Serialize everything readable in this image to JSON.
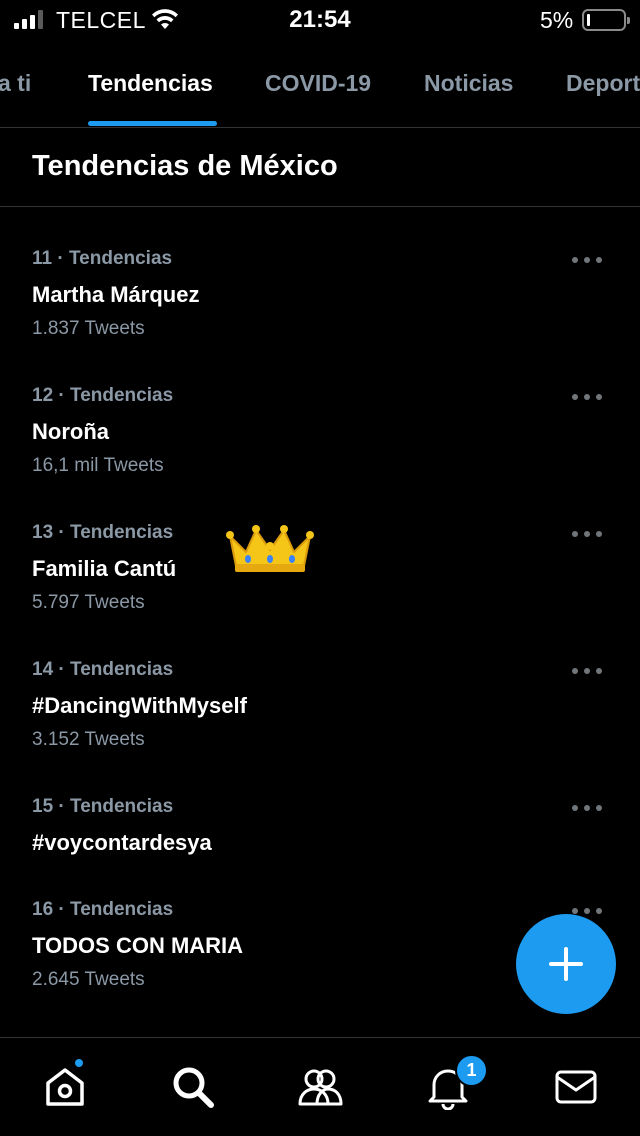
{
  "status_bar": {
    "carrier": "TELCEL",
    "time": "21:54",
    "battery_percent": "5%",
    "battery_level": 0.05,
    "icons": [
      "signal-icon",
      "wifi-icon",
      "battery-icon"
    ]
  },
  "tabs": [
    {
      "label": "a ti",
      "active": false
    },
    {
      "label": "Tendencias",
      "active": true
    },
    {
      "label": "COVID-19",
      "active": false
    },
    {
      "label": "Noticias",
      "active": false
    },
    {
      "label": "Deport",
      "active": false
    }
  ],
  "section": {
    "title": "Tendencias de México"
  },
  "trends": [
    {
      "meta": "11 · Tendencias",
      "name": "Martha Márquez",
      "count": "1.837 Tweets"
    },
    {
      "meta": "12 · Tendencias",
      "name": "Noroña",
      "count": "16,1 mil Tweets"
    },
    {
      "meta": "13 · Tendencias",
      "name": "Familia Cantú",
      "count": "5.797 Tweets"
    },
    {
      "meta": "14 · Tendencias",
      "name": "#DancingWithMyself",
      "count": "3.152 Tweets"
    },
    {
      "meta": "15 · Tendencias",
      "name": "#voycontardesya",
      "count": ""
    },
    {
      "meta": "16 · Tendencias",
      "name": "TODOS CON MARIA",
      "count": "2.645 Tweets"
    }
  ],
  "sticker": "crown-icon",
  "fab": {
    "icon": "plus-icon"
  },
  "bottom_nav": {
    "items": [
      "home-icon",
      "search-icon",
      "communities-icon",
      "notifications-icon",
      "messages-icon"
    ],
    "notifications_badge": "1"
  },
  "colors": {
    "accent": "#1d9bf0",
    "background": "#000000",
    "secondary_text": "#8b98a5"
  }
}
